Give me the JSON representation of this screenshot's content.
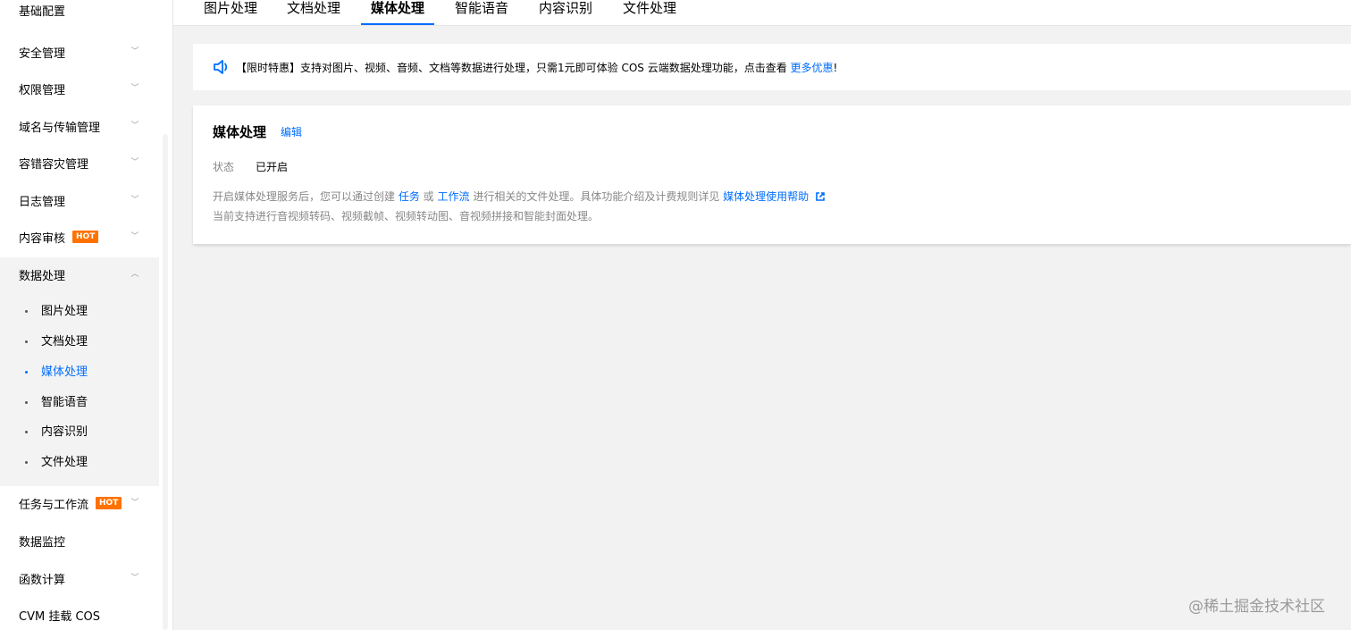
{
  "sidebar": {
    "cut_item": "基础配置",
    "items": [
      {
        "label": "安全管理"
      },
      {
        "label": "权限管理"
      },
      {
        "label": "域名与传输管理"
      },
      {
        "label": "容错容灾管理"
      },
      {
        "label": "日志管理"
      },
      {
        "label": "内容审核",
        "badge": "HOT"
      },
      {
        "label": "数据处理"
      }
    ],
    "sub_items": [
      {
        "label": "图片处理"
      },
      {
        "label": "文档处理"
      },
      {
        "label": "媒体处理"
      },
      {
        "label": "智能语音"
      },
      {
        "label": "内容识别"
      },
      {
        "label": "文件处理"
      }
    ],
    "items_after": [
      {
        "label": "任务与工作流",
        "badge": "HOT"
      },
      {
        "label": "数据监控"
      },
      {
        "label": "函数计算"
      },
      {
        "label": "CVM 挂载 COS"
      }
    ],
    "active_sub": "媒体处理"
  },
  "tabs": [
    {
      "label": "图片处理"
    },
    {
      "label": "文档处理"
    },
    {
      "label": "媒体处理"
    },
    {
      "label": "智能语音"
    },
    {
      "label": "内容识别"
    },
    {
      "label": "文件处理"
    }
  ],
  "notice": {
    "text": "【限时特惠】支持对图片、视频、音频、文档等数据进行处理，只需1元即可体验 COS 云端数据处理功能，点击查看 ",
    "link": "更多优惠",
    "tail": "!"
  },
  "card": {
    "title": "媒体处理",
    "edit": "编辑",
    "status_label": "状态",
    "status_value": "已开启",
    "desc1_a": "开启媒体处理服务后，您可以通过创建 ",
    "desc1_link1": "任务",
    "desc1_b": " 或 ",
    "desc1_link2": "工作流",
    "desc1_c": " 进行相关的文件处理。具体功能介绍及计费规则详见 ",
    "desc1_link3": "媒体处理使用帮助",
    "desc2": "当前支持进行音视频转码、视频截帧、视频转动图、音视频拼接和智能封面处理。"
  },
  "watermark": "@稀土掘金技术社区",
  "colors": {
    "accent": "#006eff",
    "hot": "#ff7200",
    "bg": "#f2f2f2"
  }
}
